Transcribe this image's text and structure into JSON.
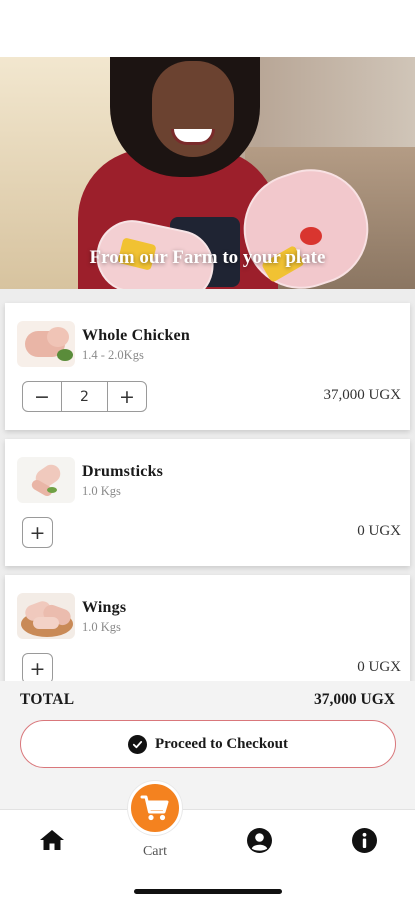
{
  "hero": {
    "tagline": "From our Farm to your plate"
  },
  "products": [
    {
      "name": "Whole Chicken",
      "weight": "1.4 - 2.0Kgs",
      "quantity": "2",
      "price": "37,000 UGX"
    },
    {
      "name": "Drumsticks",
      "weight": "1.0 Kgs",
      "price": "0 UGX"
    },
    {
      "name": "Wings",
      "weight": "1.0 Kgs",
      "price": "0 UGX"
    }
  ],
  "stepper": {
    "minus": "−",
    "plus": "+"
  },
  "summary": {
    "total_label": "TOTAL",
    "total_value": "37,000 UGX",
    "checkout_label": "Proceed to Checkout"
  },
  "nav": {
    "cart_label": "Cart",
    "items": [
      "home-icon",
      "cart-icon",
      "account-icon",
      "info-icon"
    ]
  },
  "colors": {
    "accent": "#f4821f",
    "checkout_border": "#d9777b"
  }
}
